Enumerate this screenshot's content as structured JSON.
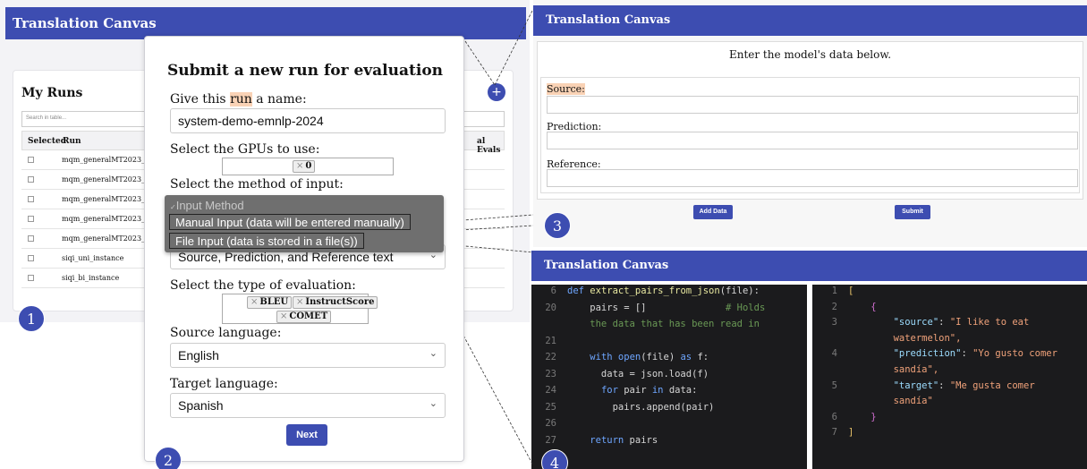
{
  "panel1": {
    "navbar_title": "Translation Canvas",
    "heading": "My Runs",
    "search_placeholder": "Search in table...",
    "columns": [
      "Selected",
      "Run",
      "al Evals"
    ],
    "runs": [
      "mqm_generalMT2023_e",
      "mqm_generalMT2023_e",
      "mqm_generalMT2023_zl",
      "mqm_generalMT2023_zl",
      "mqm_generalMT2023_zl",
      "siqi_uni_instance",
      "siqi_bi_instance"
    ],
    "add_button": "+",
    "badge": "1"
  },
  "modal": {
    "title": "Submit a new run for evaluation",
    "name_label_pre": "Give this ",
    "name_label_hl": "run",
    "name_label_post": " a name:",
    "name_value": "system-demo-emnlp-2024",
    "gpu_label": "Select the GPUs to use:",
    "gpu_tags": [
      "0"
    ],
    "input_method_label": "Select the method of input:",
    "input_method_value": "Source, Prediction, and Reference text",
    "eval_label": "Select the type of evaluation:",
    "eval_tags": [
      "BLEU",
      "InstructScore",
      "COMET"
    ],
    "source_lang_label": "Source language:",
    "source_lang_value": "English",
    "target_lang_label": "Target language:",
    "target_lang_value": "Spanish",
    "next_button": "Next",
    "badge": "2"
  },
  "dropdown": {
    "header": "Input Method",
    "options": [
      "Manual Input (data will be entered manually)",
      "File Input (data is stored in a file(s))"
    ]
  },
  "panel3": {
    "navbar_title": "Translation Canvas",
    "intro": "Enter the model's data below.",
    "source_label": "Source:",
    "prediction_label": "Prediction:",
    "reference_label": "Reference:",
    "add_data_button": "Add Data",
    "submit_button": "Submit",
    "badge": "3"
  },
  "panel4": {
    "navbar_title": "Translation Canvas",
    "badge": "4",
    "left_code": [
      {
        "n": "6",
        "t": "def extract_pairs_from_json(file):"
      },
      {
        "n": "20",
        "t": "    pairs = []              # Holds"
      },
      {
        "n": "",
        "t": "    the data that has been read in"
      },
      {
        "n": "21",
        "t": ""
      },
      {
        "n": "22",
        "t": "    with open(file) as f:"
      },
      {
        "n": "23",
        "t": "      data = json.load(f)"
      },
      {
        "n": "24",
        "t": "      for pair in data:"
      },
      {
        "n": "25",
        "t": "        pairs.append(pair)"
      },
      {
        "n": "26",
        "t": ""
      },
      {
        "n": "27",
        "t": "    return pairs"
      },
      {
        "n": "28",
        "t": ""
      }
    ],
    "right_code": [
      {
        "n": "1",
        "t": "["
      },
      {
        "n": "2",
        "t": "    {"
      },
      {
        "n": "3",
        "t": "        \"source\": \"I like to eat"
      },
      {
        "n": "",
        "t": "        watermelon\","
      },
      {
        "n": "4",
        "t": "        \"prediction\": \"Yo gusto comer"
      },
      {
        "n": "",
        "t": "        sandía\","
      },
      {
        "n": "5",
        "t": "        \"target\": \"Me gusta comer"
      },
      {
        "n": "",
        "t": "        sandía\""
      },
      {
        "n": "6",
        "t": "    }"
      },
      {
        "n": "7",
        "t": "]"
      }
    ]
  },
  "colors": {
    "navbar": "#3d4db1",
    "highlight": "#f9d2b5",
    "dropdown_bg": "#6f6f6f",
    "code_bg": "#1b1b1d"
  }
}
